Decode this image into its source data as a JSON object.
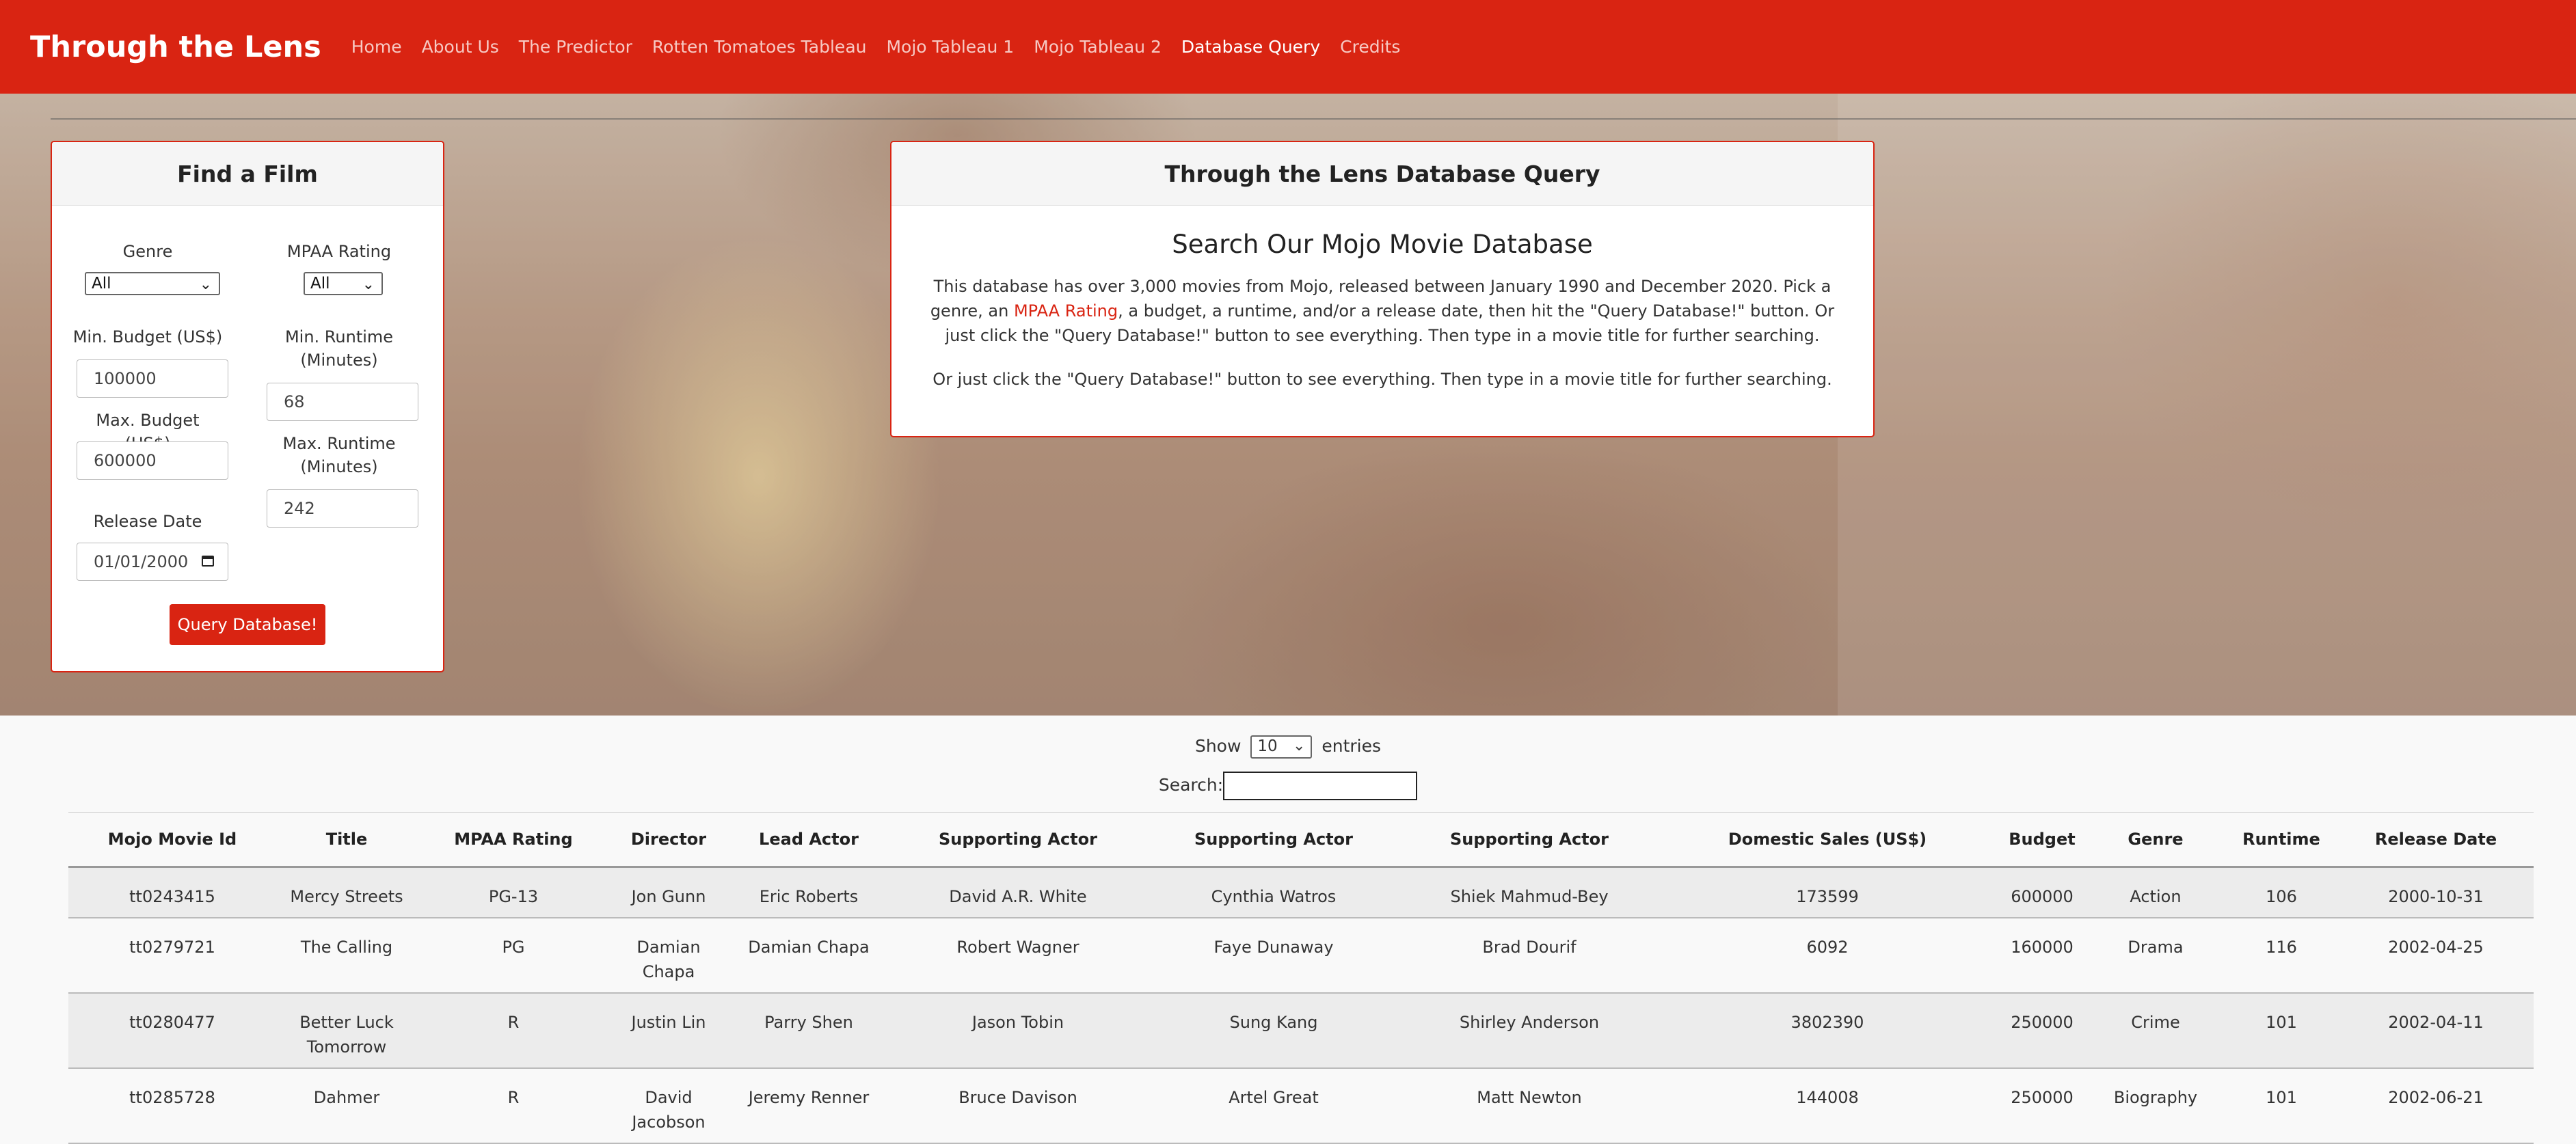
{
  "navbar": {
    "brand": "Through the Lens",
    "links": [
      {
        "label": "Home"
      },
      {
        "label": "About Us"
      },
      {
        "label": "The Predictor"
      },
      {
        "label": "Rotten Tomatoes Tableau"
      },
      {
        "label": "Mojo Tableau 1"
      },
      {
        "label": "Mojo Tableau 2"
      },
      {
        "label": "Database Query"
      },
      {
        "label": "Credits"
      }
    ],
    "active": "Database Query"
  },
  "find_card": {
    "title": "Find a Film",
    "genre_label": "Genre",
    "genre_value": "All",
    "mpaa_label": "MPAA Rating",
    "mpaa_value": "All",
    "min_budget_label": "Min. Budget (US$)",
    "min_budget_value": "100000",
    "max_budget_label": "Max. Budget (US$)",
    "max_budget_value": "600000",
    "min_runtime_label": "Min. Runtime (Minutes)",
    "min_runtime_value": "68",
    "max_runtime_label": "Max. Runtime (Minutes)",
    "max_runtime_value": "242",
    "release_date_label": "Release Date",
    "release_date_value": "01/01/2000",
    "button_label": "Query Database!"
  },
  "query_card": {
    "header": "Through the Lens Database Query",
    "title": "Search Our Mojo Movie Database",
    "para_part1": "This database has over 3,000 movies from Mojo, released between January 1990 and December 2020. Pick a genre, an ",
    "para_link": "MPAA Rating",
    "para_part2": ", a budget, a runtime, and/or a release date, then hit the \"Query Database!\" button. Or just click the \"Query Database!\" button to see everything. Then type in a movie title for further searching.",
    "para2": "Or just click the \"Query Database!\" button to see everything. Then type in a movie title for further searching."
  },
  "table_controls": {
    "show_label": "Show",
    "entries_value": "10",
    "entries_label": "entries",
    "search_label": "Search:"
  },
  "table": {
    "columns": [
      "Mojo Movie Id",
      "Title",
      "MPAA Rating",
      "Director",
      "Lead Actor",
      "Supporting Actor",
      "Supporting Actor",
      "Supporting Actor",
      "Domestic Sales (US$)",
      "Budget",
      "Genre",
      "Runtime",
      "Release Date"
    ],
    "rows": [
      [
        "tt0243415",
        "Mercy Streets",
        "PG-13",
        "Jon Gunn",
        "Eric Roberts",
        "David A.R. White",
        "Cynthia Watros",
        "Shiek Mahmud-Bey",
        "173599",
        "600000",
        "Action",
        "106",
        "2000-10-31"
      ],
      [
        "tt0279721",
        "The Calling",
        "PG",
        "Damian Chapa",
        "Damian Chapa",
        "Robert Wagner",
        "Faye Dunaway",
        "Brad Dourif",
        "6092",
        "160000",
        "Drama",
        "116",
        "2002-04-25"
      ],
      [
        "tt0280477",
        "Better Luck Tomorrow",
        "R",
        "Justin Lin",
        "Parry Shen",
        "Jason Tobin",
        "Sung Kang",
        "Shirley Anderson",
        "3802390",
        "250000",
        "Crime",
        "101",
        "2002-04-11"
      ],
      [
        "tt0285728",
        "Dahmer",
        "R",
        "David Jacobson",
        "Jeremy Renner",
        "Bruce Davison",
        "Artel Great",
        "Matt Newton",
        "144008",
        "250000",
        "Biography",
        "101",
        "2002-06-21"
      ]
    ]
  },
  "colors": {
    "brand": "#d92412",
    "card_border": "#d92412"
  }
}
